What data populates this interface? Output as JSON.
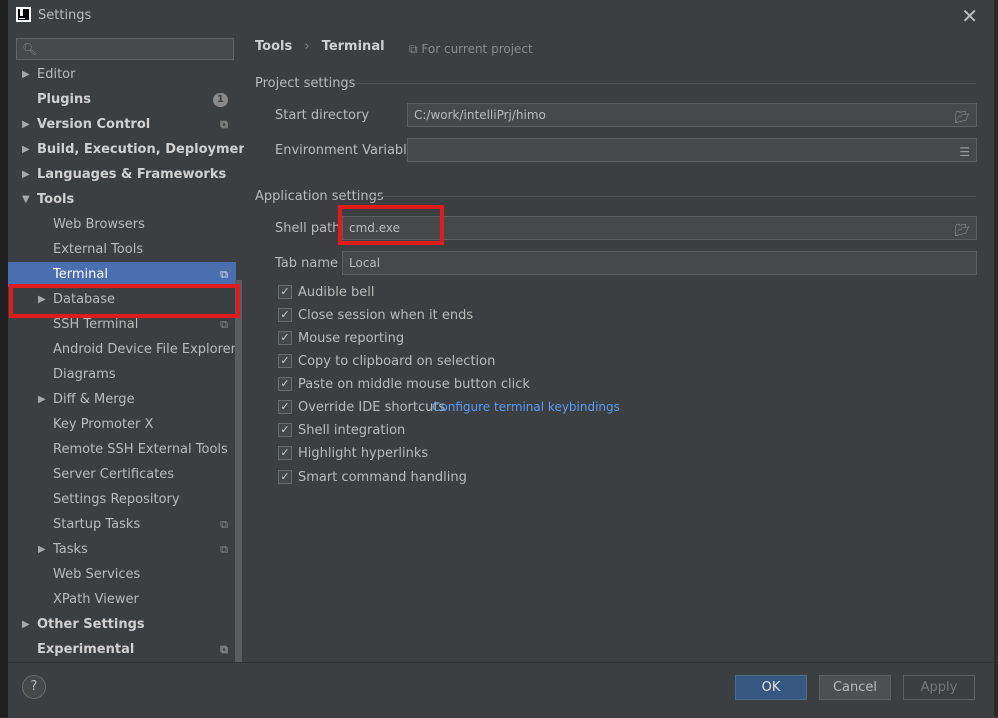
{
  "window": {
    "title": "Settings"
  },
  "search": {
    "placeholder": ""
  },
  "sidebar": {
    "items": [
      {
        "label": "Editor"
      },
      {
        "label": "Plugins",
        "badge": "1"
      },
      {
        "label": "Version Control"
      },
      {
        "label": "Build, Execution, Deployment"
      },
      {
        "label": "Languages & Frameworks"
      },
      {
        "label": "Tools"
      },
      {
        "label": "Web Browsers"
      },
      {
        "label": "External Tools"
      },
      {
        "label": "Terminal"
      },
      {
        "label": "Database"
      },
      {
        "label": "SSH Terminal"
      },
      {
        "label": "Android Device File Explorer"
      },
      {
        "label": "Diagrams"
      },
      {
        "label": "Diff & Merge"
      },
      {
        "label": "Key Promoter X"
      },
      {
        "label": "Remote SSH External Tools"
      },
      {
        "label": "Server Certificates"
      },
      {
        "label": "Settings Repository"
      },
      {
        "label": "Startup Tasks"
      },
      {
        "label": "Tasks"
      },
      {
        "label": "Web Services"
      },
      {
        "label": "XPath Viewer"
      },
      {
        "label": "Other Settings"
      },
      {
        "label": "Experimental"
      }
    ]
  },
  "breadcrumb": {
    "parent": "Tools",
    "separator": "›",
    "current": "Terminal",
    "scope": "For current project"
  },
  "project_settings": {
    "title": "Project settings",
    "start_directory_label": "Start directory",
    "start_directory_value": "C:/work/intelliPrj/himo",
    "env_vars_label": "Environment Variables",
    "env_vars_value": ""
  },
  "app_settings": {
    "title": "Application settings",
    "shell_path_label": "Shell path",
    "shell_path_value": "cmd.exe",
    "tab_name_label": "Tab name",
    "tab_name_value": "Local",
    "checkboxes": [
      {
        "label": "Audible bell",
        "checked": true
      },
      {
        "label": "Close session when it ends",
        "checked": true
      },
      {
        "label": "Mouse reporting",
        "checked": true
      },
      {
        "label": "Copy to clipboard on selection",
        "checked": true
      },
      {
        "label": "Paste on middle mouse button click",
        "checked": true
      },
      {
        "label": "Override IDE shortcuts",
        "checked": true
      },
      {
        "label": "Shell integration",
        "checked": true
      },
      {
        "label": "Highlight hyperlinks",
        "checked": true
      },
      {
        "label": "Smart command handling",
        "checked": true
      }
    ],
    "keybindings_link": "Configure terminal keybindings"
  },
  "buttons": {
    "help": "?",
    "ok": "OK",
    "cancel": "Cancel",
    "apply": "Apply"
  },
  "colors": {
    "selection": "#4b6eaf",
    "highlight_box": "#e01b1b",
    "link": "#589df6"
  }
}
